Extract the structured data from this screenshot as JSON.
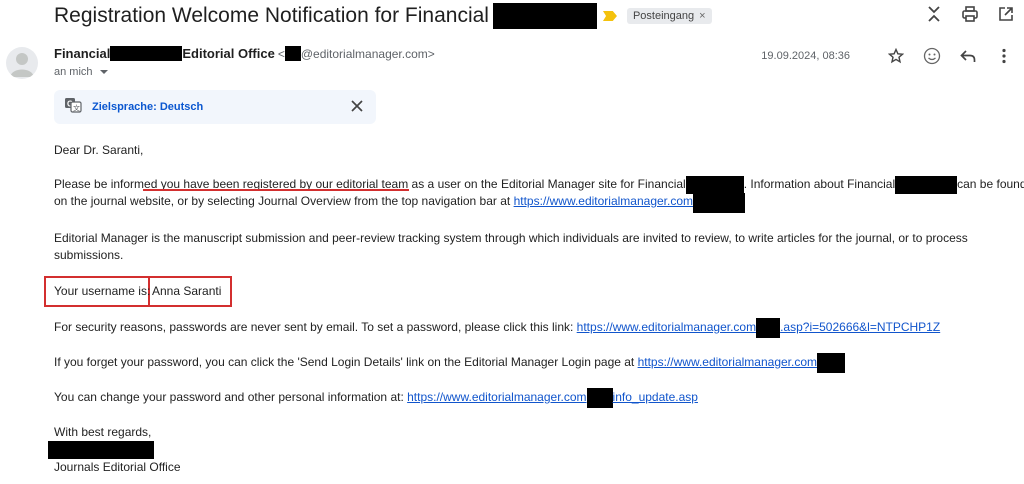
{
  "header": {
    "subject": "Registration Welcome Notification for Financial",
    "label": "Posteingang",
    "label_close": "×"
  },
  "sender": {
    "name_part1": "Financial",
    "name_part2": "Editorial Office",
    "separator": "<",
    "email_suffix": "@editorialmanager.com>",
    "to": "an mich",
    "date": "19.09.2024, 08:36"
  },
  "translate": {
    "label": "Zielsprache: Deutsch"
  },
  "body": {
    "greeting": "Dear Dr. Saranti,",
    "p1_a": "Please be informed ",
    "p1_b": "you have been registered by our editorial team",
    "p1_c": " as a user on the Editorial Manager site for Financial",
    "p1_d": ". Information about Financial",
    "p1_e": "can be found",
    "p1_line2": "on the journal website, or by selecting Journal Overview from the top navigation bar at ",
    "p1_link": "https://www.editorialmanager.com",
    "p2_line1": "Editorial Manager is the manuscript submission and peer-review tracking system through which individuals are invited to review, to write articles for the journal, or to process",
    "p2_line2": "submissions.",
    "username_label": "Your username is:",
    "username_value": "Anna Saranti",
    "p3_text": "For security reasons, passwords are never sent by email. To set a password, please click this link: ",
    "p3_link_a": "https://www.editorialmanager.com",
    "p3_link_b": ".asp?i=502666&l=NTPCHP1Z",
    "p4_text": "If you forget your password, you can click the 'Send Login Details' link on the Editorial Manager Login page at ",
    "p4_link": "https://www.editorialmanager.com",
    "p5_text": "You can change your password and other personal information at: ",
    "p5_link_a": "https://www.editorialmanager.com",
    "p5_link_b": "info_update.asp",
    "closing": "With best regards,",
    "signature": "Journals Editorial Office"
  },
  "colors": {
    "link": "#1155cc",
    "annotation_red": "#d32f2f",
    "translate_accent": "#0b57d0"
  }
}
